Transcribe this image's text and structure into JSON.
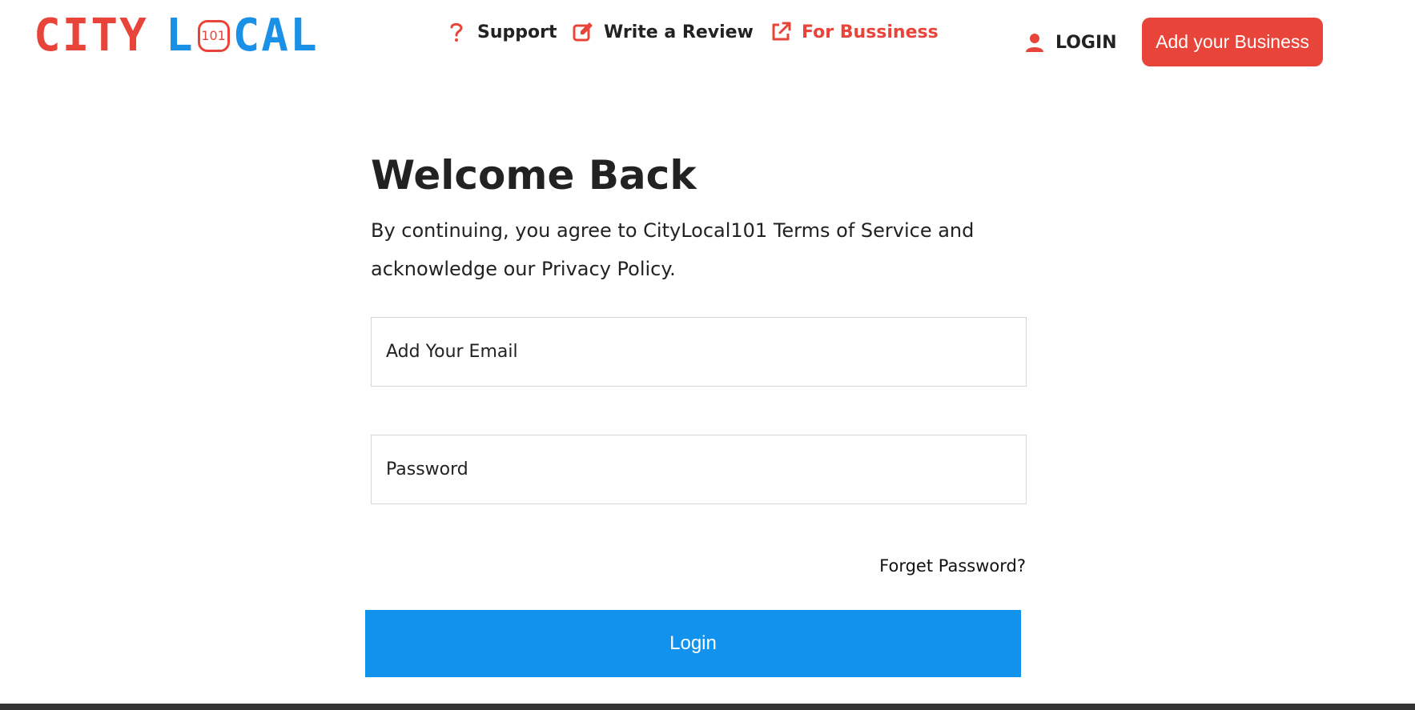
{
  "header": {
    "logo": {
      "city": "CITY",
      "local_l": "L",
      "local_badge": "101",
      "local_rest": "CAL"
    },
    "nav": {
      "support_label": "Support",
      "review_label": "Write a Review",
      "business_label": "For Bussiness",
      "login_label": "LOGIN"
    },
    "add_business_label": "Add your Business"
  },
  "main": {
    "title": "Welcome Back",
    "intro": "By continuing, you agree to CityLocal101 Terms of Service and acknowledge our Privacy Policy.",
    "email": {
      "placeholder": "Add Your Email",
      "value": ""
    },
    "password": {
      "placeholder": "Password",
      "value": ""
    },
    "forget_password_label": "Forget Password?",
    "login_button_label": "Login"
  },
  "colors": {
    "brand_red": "#e8443a",
    "brand_blue": "#1a90e6",
    "login_button": "#1192ec",
    "footer": "#333333"
  },
  "icons": {
    "support": "question-icon",
    "review": "edit-icon",
    "business": "external-link-icon",
    "login": "user-icon"
  }
}
